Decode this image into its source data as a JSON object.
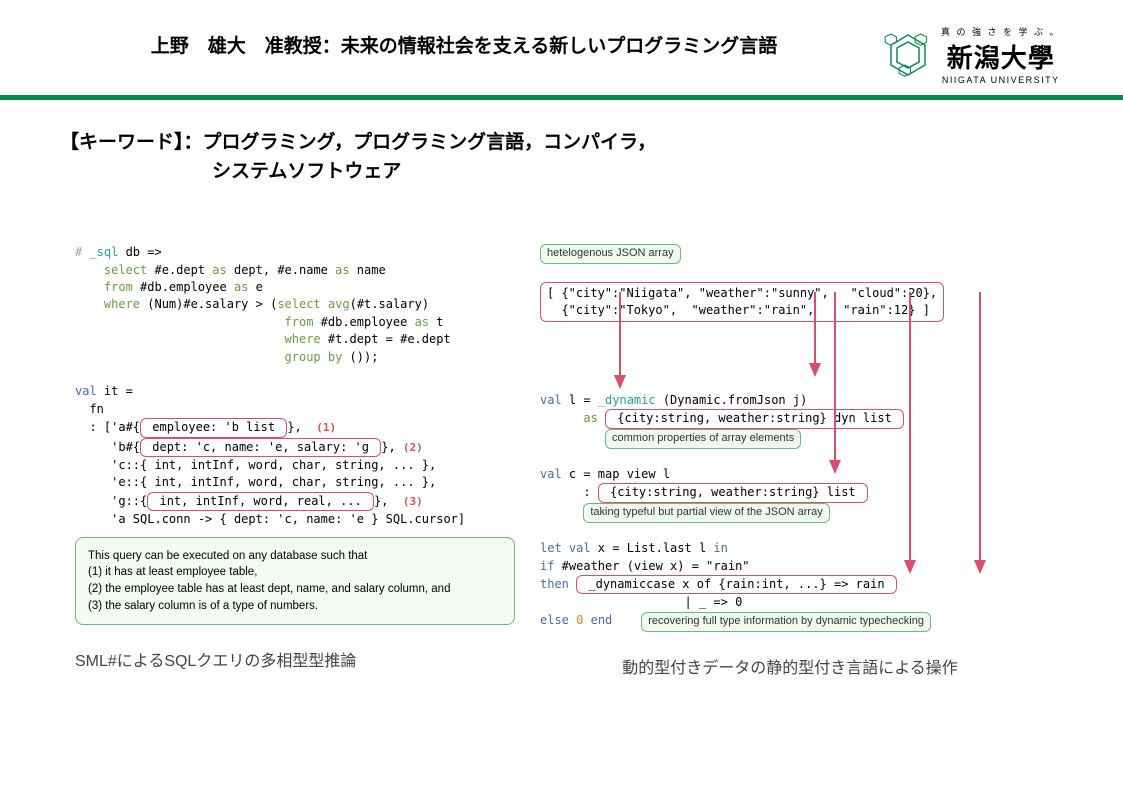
{
  "header": {
    "title": "上野　雄大　准教授：未来の情報社会を支える新しいプログラミング言語",
    "logo": {
      "tagline": "真 の 強 さ を 学 ぶ 。",
      "name": "新潟大學",
      "subtitle": "NIIGATA UNIVERSITY"
    }
  },
  "keywords": {
    "line1": "【キーワード】：プログラミング，プログラミング言語，コンパイラ，",
    "line2": "　　　　　　　　システムソフトウェア"
  },
  "left": {
    "code": {
      "l1_pre": "# ",
      "l1_sql": "_sql",
      "l1_post": " db =>",
      "l2_pre": "    ",
      "l2_select": "select",
      "l2_mid": " #e.dept ",
      "l2_as1": "as",
      "l2_mid2": " dept, #e.name ",
      "l2_as2": "as",
      "l2_post": " name",
      "l3_pre": "    ",
      "l3_from": "from",
      "l3_mid": " #db.employee ",
      "l3_as": "as",
      "l3_post": " e",
      "l4_pre": "    ",
      "l4_where": "where",
      "l4_mid": " (Num)#e.salary > (",
      "l4_select": "select",
      "l4_mid2": " ",
      "l4_avg": "avg",
      "l4_post": "(#t.salary)",
      "l5_pre": "                             ",
      "l5_from": "from",
      "l5_mid": " #db.employee ",
      "l5_as": "as",
      "l5_post": " t",
      "l6_pre": "                             ",
      "l6_where": "where",
      "l6_post": " #t.dept = #e.dept",
      "l7_pre": "                             ",
      "l7_group": "group by",
      "l7_post": " ());",
      "l8_val": "val",
      "l8_post": " it =",
      "l9": "  fn",
      "l10_pre": "  : ['a#{",
      "l10_box": " employee: 'b list ",
      "l10_post": "},",
      "l10_ann": "(1)",
      "l11_pre": "     'b#{",
      "l11_box": " dept: 'c, name: 'e, salary: 'g ",
      "l11_post": "},",
      "l11_ann": "(2)",
      "l12": "     'c::{ int, intInf, word, char, string, ... },",
      "l13": "     'e::{ int, intInf, word, char, string, ... },",
      "l14_pre": "     'g::{",
      "l14_box": " int, intInf, word, real, ... ",
      "l14_post": "},",
      "l14_ann": "(3)",
      "l15": "     'a SQL.conn -> { dept: 'c, name: 'e } SQL.cursor]"
    },
    "explain": {
      "e1": "This query can be executed on any database such that",
      "e2": "(1) it has at least employee table,",
      "e3": "(2) the employee table has at least dept, name, and salary column, and",
      "e4": "(3) the salary column is of a type of numbers."
    },
    "caption": "SML#によるSQLクエリの多相型型推論"
  },
  "right": {
    "label_hetero": "hetelogenous JSON array",
    "json_l1a": "[ {\"city\":\"Niigata\", \"weather\":\"sunny\",",
    "json_l1b": "\"cloud\":20},",
    "json_l2a": "  {\"city\":\"Tokyo\",  \"weather\":\"rain\",",
    "json_l2b": "\"rain\":12} ]",
    "block2_l1_val": "val",
    "block2_l1_post": " l = ",
    "block2_l1_dyn": "_dynamic",
    "block2_l1_rest": " (Dynamic.fromJson j)",
    "block2_l2_pre": "      ",
    "block2_l2_as": "as",
    "block2_l2_box": " {city:string, weather:string} dyn list ",
    "label_common": "common properties of array elements",
    "block3_l1_val": "val",
    "block3_l1_post": " c = map view l",
    "block3_l2_pre": "      : ",
    "block3_l2_box": " {city:string, weather:string} list ",
    "label_partial": "taking typeful but partial view of the JSON array",
    "block4_l1_let": "let val",
    "block4_l1_post": " x = List.last l ",
    "block4_l1_in": "in",
    "block4_l2_if": "if",
    "block4_l2_post": " #weather (view x) = \"rain\"",
    "block4_l3_then": "then",
    "block4_l3_box": " _dynamiccase x of {rain:int, ...} => rain ",
    "block4_l4": "                    | _ => 0",
    "block4_l5_else": "else",
    "block4_l5_num": " 0 ",
    "block4_l5_end": "end",
    "label_recover": "recovering full type information by dynamic typechecking",
    "caption": "動的型付きデータの静的型付き言語による操作"
  }
}
